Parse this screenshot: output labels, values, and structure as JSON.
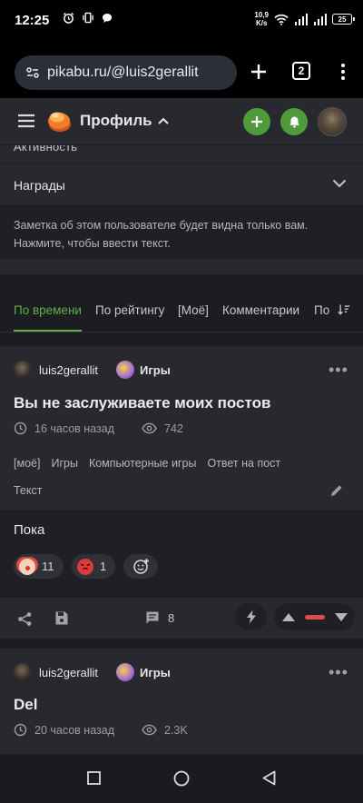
{
  "status": {
    "time": "12:25",
    "net_speed": "10,9",
    "net_unit": "K/s",
    "battery": "25"
  },
  "browser": {
    "url": "pikabu.ru/@luis2gerallit",
    "tab_count": "2"
  },
  "header": {
    "title": "Профиль"
  },
  "profile": {
    "activity_label": "Активность",
    "awards_label": "Награды",
    "note_text": "Заметка об этом пользователе будет видна только вам. Нажмите, чтобы ввести текст."
  },
  "sort_tabs": [
    "По времени",
    "По рейтингу",
    "[Моё]",
    "Комментарии",
    "По"
  ],
  "posts": [
    {
      "author": "luis2gerallit",
      "community": "Игры",
      "title": "Вы не заслуживаете моих постов",
      "time": "16 часов назад",
      "views": "742",
      "tags": [
        "[моё]",
        "Игры",
        "Компьютерные игры",
        "Ответ на пост"
      ],
      "type_tag": "Текст",
      "body": "Пока",
      "reactions": [
        {
          "emoji": "clown-face-icon",
          "count": "11"
        },
        {
          "emoji": "angry-face-icon",
          "count": "1"
        }
      ],
      "comments": "8",
      "accent": "#e14a4a"
    },
    {
      "author": "luis2gerallit",
      "community": "Игры",
      "title": "Del",
      "time": "20 часов назад",
      "views": "2.3K"
    }
  ],
  "colors": {
    "accent_green": "#5fb04a",
    "header_bg": "#27292e",
    "page_bg": "#1c1d21"
  }
}
